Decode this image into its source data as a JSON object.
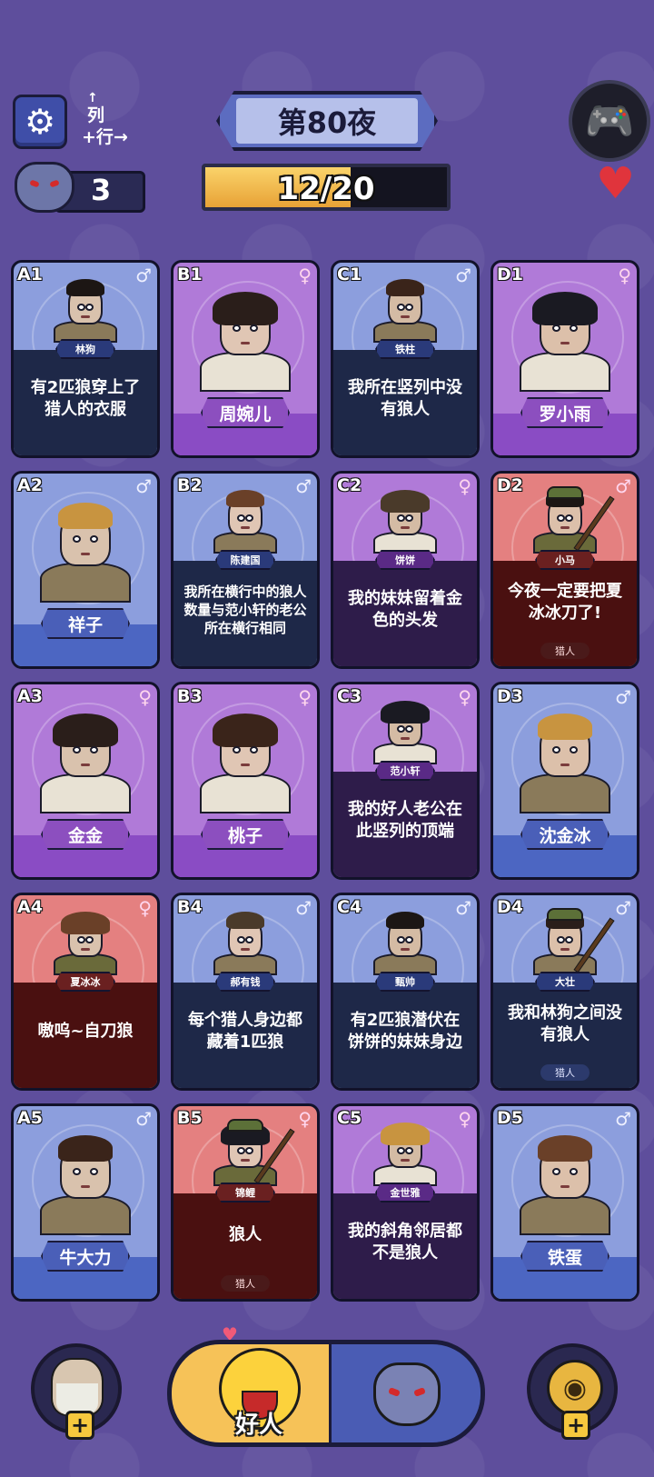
{
  "header": {
    "night_title": "第80夜",
    "progress_text": "12/20",
    "progress_value": 0.6,
    "col_label": "列",
    "row_label": "行",
    "wolf_count": "3",
    "settings_icon": "gear-icon",
    "gamepad_icon": "gamepad-icon",
    "heart_icon": "heart-icon"
  },
  "cards": [
    {
      "coord": "A1",
      "gender": "♂",
      "name": "林狗",
      "clue": "有2匹狼穿上了猎人的衣服",
      "color": "blue",
      "tag": ""
    },
    {
      "coord": "B1",
      "gender": "♀",
      "name": "周婉儿",
      "clue": "",
      "color": "purple",
      "tag": ""
    },
    {
      "coord": "C1",
      "gender": "♂",
      "name": "铁柱",
      "clue": "我所在竖列中没有狼人",
      "color": "blue",
      "tag": ""
    },
    {
      "coord": "D1",
      "gender": "♀",
      "name": "罗小雨",
      "clue": "",
      "color": "purple",
      "tag": ""
    },
    {
      "coord": "A2",
      "gender": "♂",
      "name": "祥子",
      "clue": "",
      "color": "blue",
      "tag": ""
    },
    {
      "coord": "B2",
      "gender": "♂",
      "name": "陈建国",
      "clue": "我所在横行中的狼人数量与范小轩的老公所在横行相同",
      "color": "blue",
      "tag": ""
    },
    {
      "coord": "C2",
      "gender": "♀",
      "name": "饼饼",
      "clue": "我的妹妹留着金色的头发",
      "color": "purple",
      "tag": ""
    },
    {
      "coord": "D2",
      "gender": "♂",
      "name": "小马",
      "clue": "今夜一定要把夏冰冰刀了!",
      "color": "red",
      "tag": "猎人"
    },
    {
      "coord": "A3",
      "gender": "♀",
      "name": "金金",
      "clue": "",
      "color": "purple",
      "tag": ""
    },
    {
      "coord": "B3",
      "gender": "♀",
      "name": "桃子",
      "clue": "",
      "color": "purple",
      "tag": ""
    },
    {
      "coord": "C3",
      "gender": "♀",
      "name": "范小轩",
      "clue": "我的好人老公在此竖列的顶端",
      "color": "purple",
      "tag": ""
    },
    {
      "coord": "D3",
      "gender": "♂",
      "name": "沈金冰",
      "clue": "",
      "color": "blue",
      "tag": ""
    },
    {
      "coord": "A4",
      "gender": "♀",
      "name": "夏冰冰",
      "clue": "嗷呜~自刀狼",
      "color": "red",
      "tag": ""
    },
    {
      "coord": "B4",
      "gender": "♂",
      "name": "郝有钱",
      "clue": "每个猎人身边都藏着1匹狼",
      "color": "blue",
      "tag": ""
    },
    {
      "coord": "C4",
      "gender": "♂",
      "name": "甄帅",
      "clue": "有2匹狼潜伏在饼饼的妹妹身边",
      "color": "blue",
      "tag": ""
    },
    {
      "coord": "D4",
      "gender": "♂",
      "name": "大壮",
      "clue": "我和林狗之间没有狼人",
      "color": "blue",
      "tag": "猎人"
    },
    {
      "coord": "A5",
      "gender": "♂",
      "name": "牛大力",
      "clue": "",
      "color": "blue",
      "tag": ""
    },
    {
      "coord": "B5",
      "gender": "♀",
      "name": "锦鲤",
      "clue": "狼人",
      "color": "red",
      "tag": "猎人"
    },
    {
      "coord": "C5",
      "gender": "♀",
      "name": "金世雅",
      "clue": "我的斜角邻居都不是狼人",
      "color": "purple",
      "tag": ""
    },
    {
      "coord": "D5",
      "gender": "♂",
      "name": "铁蛋",
      "clue": "",
      "color": "blue",
      "tag": ""
    }
  ],
  "bottom": {
    "good_label": "好人",
    "plus_symbol": "+",
    "left_icon": "old-man-icon",
    "right_icon": "eye-icon",
    "wolf_icon": "wolf-icon"
  }
}
